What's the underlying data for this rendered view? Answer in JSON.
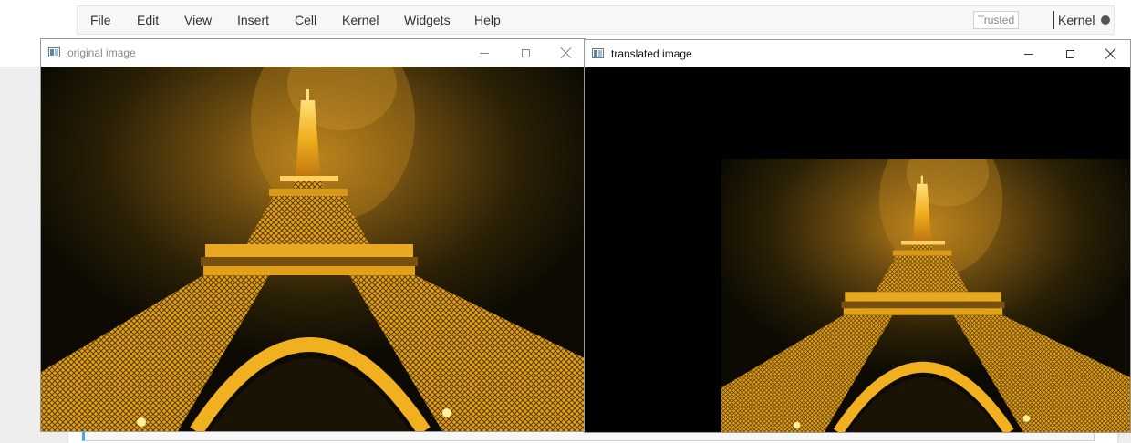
{
  "jupyter": {
    "menu": [
      "File",
      "Edit",
      "View",
      "Insert",
      "Cell",
      "Kernel",
      "Widgets",
      "Help"
    ],
    "trusted_label": "Trusted",
    "kernel_label": "Kernel"
  },
  "windows": [
    {
      "title": "original image",
      "state": "inactive"
    },
    {
      "title": "translated image",
      "state": "active"
    }
  ],
  "colors": {
    "night_sky": "#0c0a02",
    "glow": "#b8801a",
    "tower_light": "#f0b020",
    "tower_bright": "#ffe07a"
  }
}
